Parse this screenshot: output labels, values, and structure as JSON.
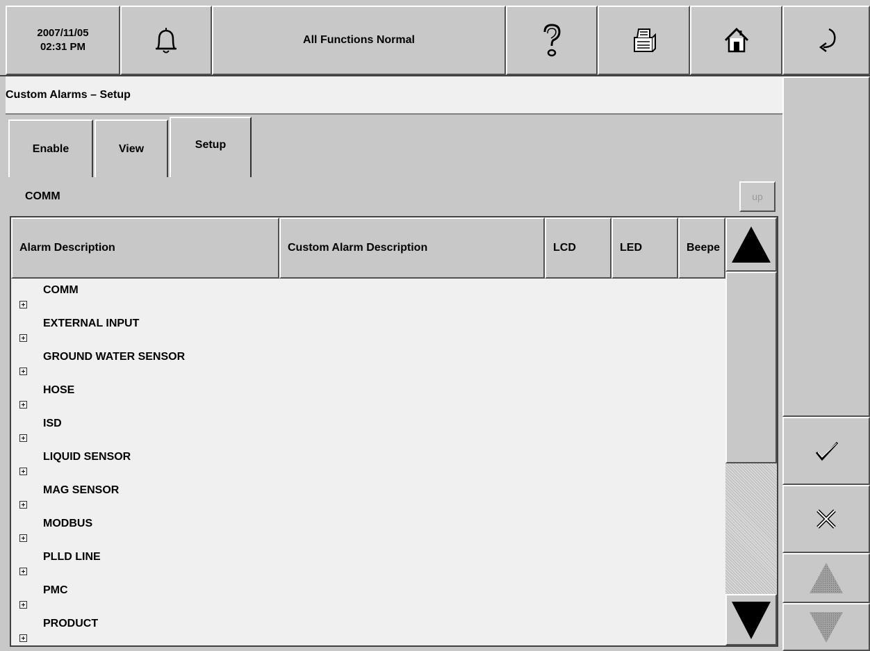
{
  "topbar": {
    "date": "2007/11/05",
    "time": "02:31 PM",
    "status": "All Functions Normal",
    "icons": [
      "bell-icon",
      "help-icon",
      "printer-icon",
      "home-icon",
      "back-icon"
    ]
  },
  "page": {
    "title": "Custom Alarms – Setup"
  },
  "tabs": [
    {
      "label": "Enable",
      "active": false
    },
    {
      "label": "View",
      "active": false
    },
    {
      "label": "Setup",
      "active": true
    }
  ],
  "group": {
    "label": "COMM",
    "up_label": "up"
  },
  "table": {
    "columns": [
      "Alarm Description",
      "Custom Alarm Description",
      "LCD",
      "LED",
      "Beepe"
    ],
    "rows": [
      "COMM",
      "EXTERNAL INPUT",
      "GROUND WATER SENSOR",
      "HOSE",
      "ISD",
      "LIQUID SENSOR",
      "MAG SENSOR",
      "MODBUS",
      "PLLD LINE",
      "PMC",
      "PRODUCT"
    ]
  },
  "side_panel": {
    "icons": [
      "checkmark-icon",
      "cancel-icon",
      "page-up-icon",
      "page-down-icon"
    ]
  },
  "colors": {
    "background": "#c8c8c8",
    "content": "#f0f0f0",
    "disabled": "#9a9a9a"
  }
}
